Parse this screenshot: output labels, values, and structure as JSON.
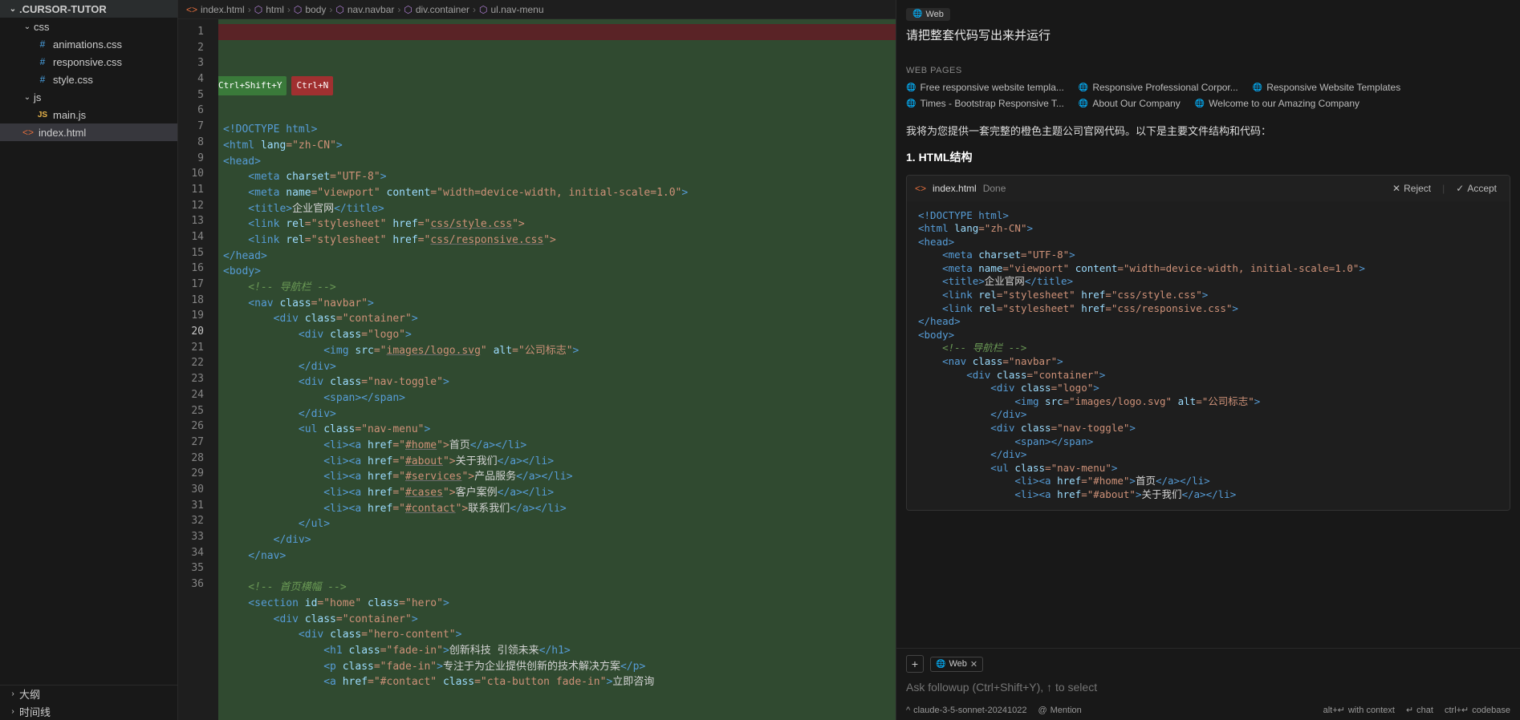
{
  "sidebar": {
    "root": ".CURSOR-TUTOR",
    "folders": {
      "css": "css",
      "js": "js"
    },
    "files": {
      "animations": "animations.css",
      "responsive": "responsive.css",
      "style": "style.css",
      "mainjs": "main.js",
      "indexhtml": "index.html"
    },
    "outline": "大纲",
    "timeline": "时间线"
  },
  "breadcrumb": {
    "file": "index.html",
    "items": [
      "html",
      "body",
      "nav.navbar",
      "div.container",
      "ul.nav-menu"
    ]
  },
  "hints": {
    "g": "Ctrl+Shift+Y",
    "r": "Ctrl+N"
  },
  "code": {
    "l1": "<!DOCTYPE html>",
    "l2a": "<html ",
    "l2b": "lang",
    "l2c": "=\"zh-CN\"",
    "l2d": ">",
    "l3": "<head>",
    "l4a": "    <meta ",
    "l4b": "charset",
    "l4c": "=\"UTF-8\"",
    "l4d": ">",
    "l5a": "    <meta ",
    "l5b": "name",
    "l5c": "=\"viewport\"",
    "l5d": " content",
    "l5e": "=\"width=device-width, initial-scale=1.0\"",
    "l5f": ">",
    "l6a": "    <title>",
    "l6b": "企业官网",
    "l6c": "</title>",
    "l7a": "    <link ",
    "l7b": "rel",
    "l7c": "=\"stylesheet\"",
    "l7d": " href",
    "l7e": "=\"",
    "l7f": "css/style.css",
    "l7g": "\">",
    "l8a": "    <link ",
    "l8b": "rel",
    "l8c": "=\"stylesheet\"",
    "l8d": " href",
    "l8e": "=\"",
    "l8f": "css/responsive.css",
    "l8g": "\">",
    "l9": "</head>",
    "l10": "<body>",
    "l11": "    <!-- 导航栏 -->",
    "l12a": "    <nav ",
    "l12b": "class",
    "l12c": "=\"navbar\"",
    "l12d": ">",
    "l13a": "        <div ",
    "l13b": "class",
    "l13c": "=\"container\"",
    "l13d": ">",
    "l14a": "            <div ",
    "l14b": "class",
    "l14c": "=\"logo\"",
    "l14d": ">",
    "l15a": "                <img ",
    "l15b": "src",
    "l15c": "=\"",
    "l15d": "images/logo.svg",
    "l15e": "\"",
    "l15f": " alt",
    "l15g": "=\"公司标志\"",
    "l15h": ">",
    "l16": "            </div>",
    "l17a": "            <div ",
    "l17b": "class",
    "l17c": "=\"nav-toggle\"",
    "l17d": ">",
    "l18": "                <span></span>",
    "l19": "            </div>",
    "l20a": "            <ul ",
    "l20b": "class",
    "l20c": "=\"nav-menu\"",
    "l20d": ">",
    "l21a": "                <li><a ",
    "l21b": "href",
    "l21c": "=\"",
    "l21d": "#home",
    "l21e": "\">",
    "l21f": "首页",
    "l21g": "</a></li>",
    "l22a": "                <li><a ",
    "l22b": "href",
    "l22c": "=\"",
    "l22d": "#about",
    "l22e": "\">",
    "l22f": "关于我们",
    "l22g": "</a></li>",
    "l23a": "                <li><a ",
    "l23b": "href",
    "l23c": "=\"",
    "l23d": "#services",
    "l23e": "\">",
    "l23f": "产品服务",
    "l23g": "</a></li>",
    "l24a": "                <li><a ",
    "l24b": "href",
    "l24c": "=\"",
    "l24d": "#cases",
    "l24e": "\">",
    "l24f": "客户案例",
    "l24g": "</a></li>",
    "l25a": "                <li><a ",
    "l25b": "href",
    "l25c": "=\"",
    "l25d": "#contact",
    "l25e": "\">",
    "l25f": "联系我们",
    "l25g": "</a></li>",
    "l26": "            </ul>",
    "l27": "        </div>",
    "l28": "    </nav>",
    "l29": "",
    "l30": "    <!-- 首页横幅 -->",
    "l31a": "    <section ",
    "l31b": "id",
    "l31c": "=\"home\"",
    "l31d": " class",
    "l31e": "=\"hero\"",
    "l31f": ">",
    "l32a": "        <div ",
    "l32b": "class",
    "l32c": "=\"container\"",
    "l32d": ">",
    "l33a": "            <div ",
    "l33b": "class",
    "l33c": "=\"hero-content\"",
    "l33d": ">",
    "l34a": "                <h1 ",
    "l34b": "class",
    "l34c": "=\"fade-in\"",
    "l34d": ">",
    "l34e": "创新科技 引领未来",
    "l34f": "</h1>",
    "l35a": "                <p ",
    "l35b": "class",
    "l35c": "=\"fade-in\"",
    "l35d": ">",
    "l35e": "专注于为企业提供创新的技术解决方案",
    "l35f": "</p>",
    "l36a": "                <a ",
    "l36b": "href",
    "l36c": "=\"#contact\"",
    "l36d": " class",
    "l36e": "=\"cta-button fade-in\"",
    "l36f": ">",
    "l36g": "立即咨询"
  },
  "chat": {
    "web_chip": "Web",
    "prompt": "请把整套代码写出来并运行",
    "wp_header": "WEB PAGES",
    "wp": [
      "Free responsive website templa...",
      "Responsive Professional Corpor...",
      "Responsive Website Templates",
      "Times - Bootstrap Responsive T...",
      "About Our Company",
      "Welcome to our Amazing Company"
    ],
    "resp1": "我将为您提供一套完整的橙色主题公司官网代码。以下是主要文件结构和代码：",
    "resp_h1": "1. HTML结构",
    "card": {
      "file": "index.html",
      "done": "Done",
      "reject": "Reject",
      "accept": "Accept"
    },
    "card_code": {
      "c1": "<!DOCTYPE html>",
      "c2": "<html lang=\"zh-CN\">",
      "c3": "<head>",
      "c4": "    <meta charset=\"UTF-8\">",
      "c5": "    <meta name=\"viewport\" content=\"width=device-width, initial-scale=1.0\">",
      "c6": "    <title>企业官网</title>",
      "c7": "    <link rel=\"stylesheet\" href=\"css/style.css\">",
      "c8": "    <link rel=\"stylesheet\" href=\"css/responsive.css\">",
      "c9": "</head>",
      "c10": "<body>",
      "c11": "    <!-- 导航栏 -->",
      "c12": "    <nav class=\"navbar\">",
      "c13": "        <div class=\"container\">",
      "c14": "            <div class=\"logo\">",
      "c15": "                <img src=\"images/logo.svg\" alt=\"公司标志\">",
      "c16": "            </div>",
      "c17": "            <div class=\"nav-toggle\">",
      "c18": "                <span></span>",
      "c19": "            </div>",
      "c20": "            <ul class=\"nav-menu\">",
      "c21": "                <li><a href=\"#home\">首页</a></li>",
      "c22": "                <li><a href=\"#about\">关于我们</a></li>"
    },
    "web_pill": "Web",
    "followup_ph": "Ask followup (Ctrl+Shift+Y), ↑ to select",
    "model": "claude-3-5-sonnet-20241022",
    "mention": "Mention",
    "with_context": "with context",
    "chat_lbl": "chat",
    "codebase": "codebase",
    "kbd_altenter": "alt+↵",
    "kbd_enter": "↵",
    "kbd_ctrlenter": "ctrl+↵"
  }
}
